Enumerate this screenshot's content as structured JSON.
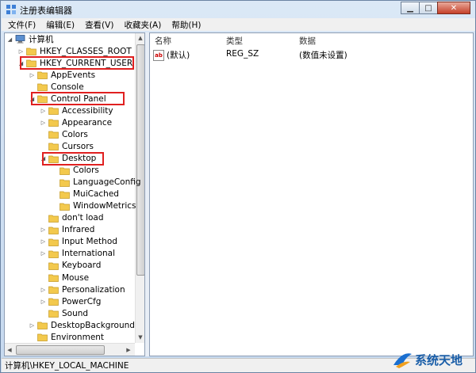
{
  "window": {
    "title": "注册表编辑器"
  },
  "menu": [
    "文件(F)",
    "编辑(E)",
    "查看(V)",
    "收藏夹(A)",
    "帮助(H)"
  ],
  "tree": [
    {
      "label": "计算机",
      "exp": "down",
      "level": 0,
      "icon": "computer-icon"
    },
    {
      "label": "HKEY_CLASSES_ROOT",
      "exp": "right",
      "level": 1
    },
    {
      "label": "HKEY_CURRENT_USER",
      "exp": "down",
      "level": 1,
      "highlight": true
    },
    {
      "label": "AppEvents",
      "exp": "right",
      "level": 2
    },
    {
      "label": "Console",
      "exp": "",
      "level": 2
    },
    {
      "label": "Control Panel",
      "exp": "down",
      "level": 2,
      "highlight": true
    },
    {
      "label": "Accessibility",
      "exp": "right",
      "level": 3
    },
    {
      "label": "Appearance",
      "exp": "right",
      "level": 3
    },
    {
      "label": "Colors",
      "exp": "",
      "level": 3
    },
    {
      "label": "Cursors",
      "exp": "",
      "level": 3
    },
    {
      "label": "Desktop",
      "exp": "down",
      "level": 3,
      "highlight": true
    },
    {
      "label": "Colors",
      "exp": "",
      "level": 4
    },
    {
      "label": "LanguageConfig",
      "exp": "",
      "level": 4
    },
    {
      "label": "MuiCached",
      "exp": "",
      "level": 4
    },
    {
      "label": "WindowMetrics",
      "exp": "",
      "level": 4
    },
    {
      "label": "don't load",
      "exp": "",
      "level": 3
    },
    {
      "label": "Infrared",
      "exp": "right",
      "level": 3
    },
    {
      "label": "Input Method",
      "exp": "right",
      "level": 3
    },
    {
      "label": "International",
      "exp": "right",
      "level": 3
    },
    {
      "label": "Keyboard",
      "exp": "",
      "level": 3
    },
    {
      "label": "Mouse",
      "exp": "",
      "level": 3
    },
    {
      "label": "Personalization",
      "exp": "right",
      "level": 3
    },
    {
      "label": "PowerCfg",
      "exp": "right",
      "level": 3
    },
    {
      "label": "Sound",
      "exp": "",
      "level": 3
    },
    {
      "label": "DesktopBackground",
      "exp": "right",
      "level": 2
    },
    {
      "label": "Environment",
      "exp": "",
      "level": 2
    }
  ],
  "list": {
    "columns": [
      "名称",
      "类型",
      "数据"
    ],
    "rows": [
      {
        "icon": "ab",
        "name": "(默认)",
        "type": "REG_SZ",
        "data": "(数值未设置)"
      }
    ]
  },
  "status": "计算机\\HKEY_LOCAL_MACHINE",
  "watermark": "系统天地",
  "colors": {
    "highlight": "#e02020",
    "folder": "#f3c94d"
  }
}
